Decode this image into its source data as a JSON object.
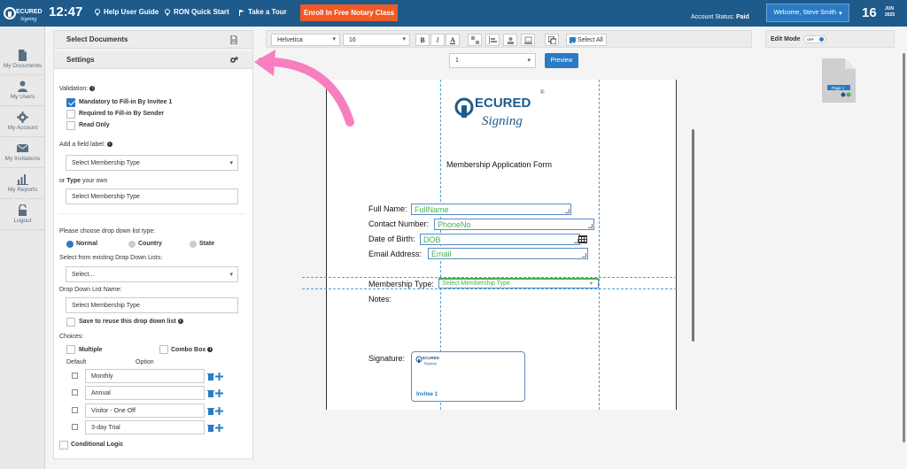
{
  "topbar": {
    "logo_text": "SECURED Signing",
    "clock": "12:47",
    "help_guide": "Help User Guide",
    "ron_guide": "RON Quick Start",
    "tour": "Take a Tour",
    "enroll": "Enroll In Free Notary Class",
    "account_status_label": "Account Status:",
    "account_status_value": "Paid",
    "welcome": "Welcome,  Steve Smith",
    "date_day": "16",
    "date_month": "JUN",
    "date_year": "2025"
  },
  "sidebar": {
    "items": [
      {
        "label": "My Documents",
        "icon": "document-icon"
      },
      {
        "label": "My Users",
        "icon": "user-icon"
      },
      {
        "label": "My Account",
        "icon": "gear-icon"
      },
      {
        "label": "My Invitations",
        "icon": "envelope-icon"
      },
      {
        "label": "My Reports",
        "icon": "bar-chart-icon"
      },
      {
        "label": "Logout",
        "icon": "lock-icon"
      }
    ]
  },
  "panels": {
    "select_documents": "Select Documents",
    "settings": "Settings"
  },
  "settings": {
    "validation_label": "Validation:",
    "mandatory": "Mandatory to Fill-in By Invitee 1",
    "required_sender": "Required to Fill-in By Sender",
    "read_only": "Read Only",
    "add_field_label": "Add a field label:",
    "field_label_select": "Select Membership Type",
    "or_type_prefix": "or",
    "or_type_bold": "Type",
    "or_type_suffix": "your own",
    "field_label_input": "Select Membership Type",
    "list_type_label": "Please choose drop down list type:",
    "radio_normal": "Normal",
    "radio_country": "Country",
    "radio_state": "State",
    "existing_lists_label": "Select from existing Drop Down Lists:",
    "existing_lists_select": "Select...",
    "list_name_label": "Drop Down List Name:",
    "list_name_input": "Select Membership Type",
    "save_reuse": "Save to reuse this drop down list",
    "choices_label": "Choices:",
    "multiple": "Multiple",
    "combo_box": "Combo Box",
    "col_default": "Default",
    "col_option": "Option",
    "options": [
      "Monthly",
      "Annual",
      "Visitor - One Off",
      "3-day Trial"
    ],
    "conditional_logic": "Conditional Logic"
  },
  "toolbar": {
    "font": "Helvetica",
    "size": "16",
    "bold": "B",
    "italic": "I",
    "underline": "A",
    "select_all": "Select All"
  },
  "pager": {
    "page": "1",
    "preview": "Preview"
  },
  "document": {
    "logo_text": "SECURED Signing",
    "title": "Membership Application Form",
    "full_name_label": "Full Name:",
    "full_name_field": "FullName",
    "contact_label": "Contact Number:",
    "contact_field": "PhoneNo",
    "dob_label": "Date of Birth:",
    "dob_field": "DOB",
    "email_label": "Email Address:",
    "email_field": "Email",
    "membership_label": "Membership Type:",
    "membership_field": "Select Membership Type",
    "notes_label": "Notes:",
    "signature_label": "Signature:",
    "signature_invitee": "Invitee 1"
  },
  "right_panel": {
    "edit_mode": "Edit Mode",
    "toggle": "OFF",
    "thumbnail_label": "Page 1"
  },
  "colors": {
    "topbar": "#1e5a8a",
    "accent": "#2a7bc4",
    "enroll": "#f05a28",
    "field_text": "#4caf50",
    "annotation_arrow": "#f77fbf"
  }
}
